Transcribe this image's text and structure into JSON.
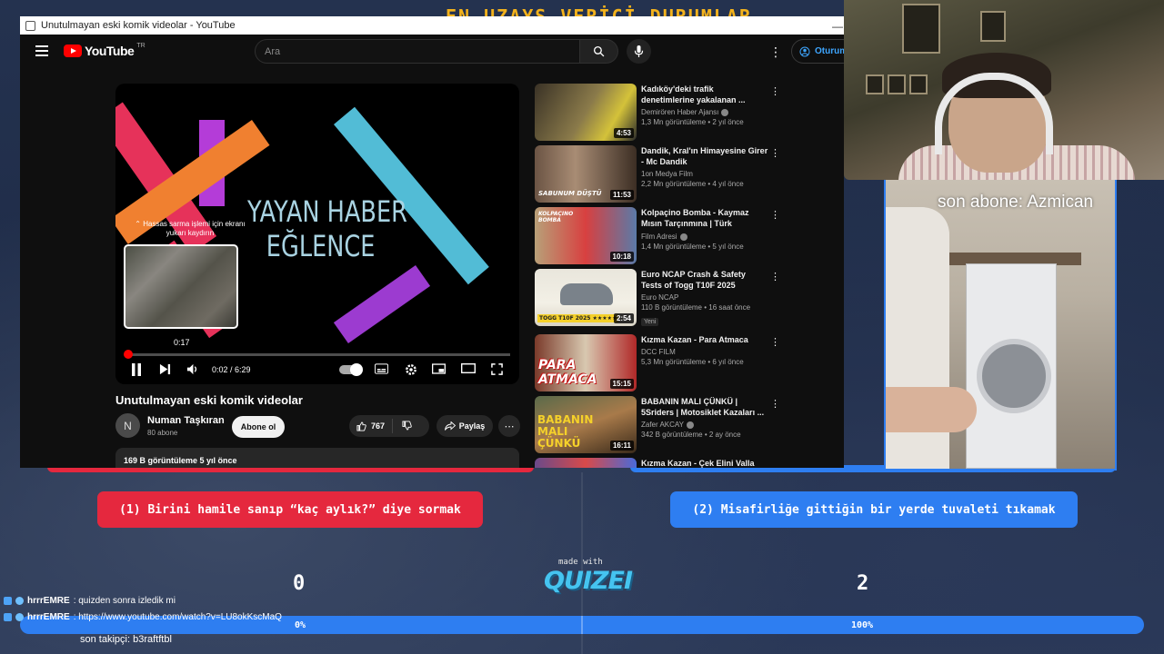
{
  "background": {
    "banner": "EN UZAYS VERİCİ DURUMLAR",
    "answer_left": "(1) Birini hamile sanıp “kaç aylık?” diye sormak",
    "answer_right": "(2) Misafirliğe gittiğin bir yerde tuvaleti tıkamak",
    "made_with": "made with",
    "brand": "QUIZEI",
    "score_left": "0",
    "score_right": "2",
    "pct_left": "0%",
    "pct_right": "100%",
    "vote_share_right": 1.0,
    "colors": {
      "red": "#e5283e",
      "blue": "#2e7ef1",
      "accent_yellow": "#f3b21c"
    }
  },
  "chat": [
    {
      "user": "hrrrEMRE",
      "text": ": quizden sonra izledik mi"
    },
    {
      "user": "hrrrEMRE",
      "text": ": https://www.youtube.com/watch?v=LU8okKscMaQ"
    }
  ],
  "follower": "son takipçi: b3raftftbl",
  "last_sub": "son abone: Azmican",
  "window": {
    "title": "Unutulmayan eski komik videolar - YouTube",
    "minimize": "—"
  },
  "youtube": {
    "logo_text": "YouTube",
    "region": "TR",
    "search_placeholder": "Ara",
    "signin": "Oturum",
    "player": {
      "overlay_line1": "YAYAN HABER",
      "overlay_line2": "EĞLENCE",
      "scroll_hint": "⌃ Hassas sarma işlemi için ekranı yukarı kaydırın",
      "preview_time": "0:17",
      "time": "0:02 / 6:29",
      "progress": 0.005
    },
    "video_title": "Unutulmayan eski komik videolar",
    "channel_initial": "N",
    "channel": "Numan Taşkıran",
    "subs": "80 abone",
    "subscribe": "Abone ol",
    "likes": "767",
    "share": "Paylaş",
    "description_meta": "169 B görüntüleme  5 yıl önce"
  },
  "recommendations": [
    {
      "title": "Kadıköy'deki trafik denetimlerine yakalanan ...",
      "channel": "Demirören Haber Ajansı",
      "verified": true,
      "meta": "1,3 Mn görüntüleme • 2 yıl önce",
      "duration": "4:53",
      "thumb_colors": [
        "#3a3226",
        "#8a7a4a",
        "#d4c23a"
      ]
    },
    {
      "title": "Dandik, Kral'ın Himayesine Girer - Mc Dandik",
      "channel": "1on Medya Film",
      "verified": false,
      "meta": "2,2 Mn görüntüleme • 4 yıl önce",
      "duration": "11:53",
      "thumb_label": "SABUNUM DÜŞTÜ",
      "thumb_colors": [
        "#6b5444",
        "#a88c74",
        "#3c2e24"
      ]
    },
    {
      "title": "Kolpaçino Bomba - Kaymaz Mısın Tarçınmına | Türk Komedi...",
      "channel": "Film Adresi",
      "verified": true,
      "meta": "1,4 Mn görüntüleme • 5 yıl önce",
      "duration": "10:18",
      "thumb_label": "KOLPAÇINO BOMBA",
      "thumb_colors": [
        "#b8a078",
        "#d84040",
        "#5a7aa8"
      ]
    },
    {
      "title": "Euro NCAP Crash & Safety Tests of Togg T10F 2025",
      "channel": "Euro NCAP",
      "verified": false,
      "meta": "110 B görüntüleme • 16 saat önce",
      "duration": "2:54",
      "badge": "Yeni",
      "thumb_label": "TOGG T10F 2025 ★★★★★",
      "thumb_colors": [
        "#e9e6dc",
        "#f5d12a",
        "#7a828a"
      ]
    },
    {
      "title": "Kızma Kazan - Para Atmaca",
      "channel": "DCC FILM",
      "verified": false,
      "meta": "5,3 Mn görüntüleme • 6 yıl önce",
      "duration": "15:15",
      "thumb_label": "PARA ATMACA",
      "thumb_colors": [
        "#7a3a2a",
        "#d8c8b0",
        "#b02828"
      ]
    },
    {
      "title": "BABANIN MALI ÇÜNKÜ | 5Sriders | Motosiklet Kazaları ...",
      "channel": "Zafer AKCAY",
      "verified": true,
      "meta": "342 B görüntüleme • 2 ay önce",
      "duration": "16:11",
      "thumb_label": "BABANIN MALI ÇÜNKÜ",
      "thumb_colors": [
        "#5a6a4a",
        "#a87a4a",
        "#d8a040"
      ]
    },
    {
      "title": "Kızma Kazan - Çek Elini Valla",
      "channel": "",
      "verified": false,
      "meta": "",
      "duration": "",
      "thumb_colors": [
        "#6a4a8a",
        "#d84a4a",
        "#4a6ad8"
      ]
    }
  ]
}
